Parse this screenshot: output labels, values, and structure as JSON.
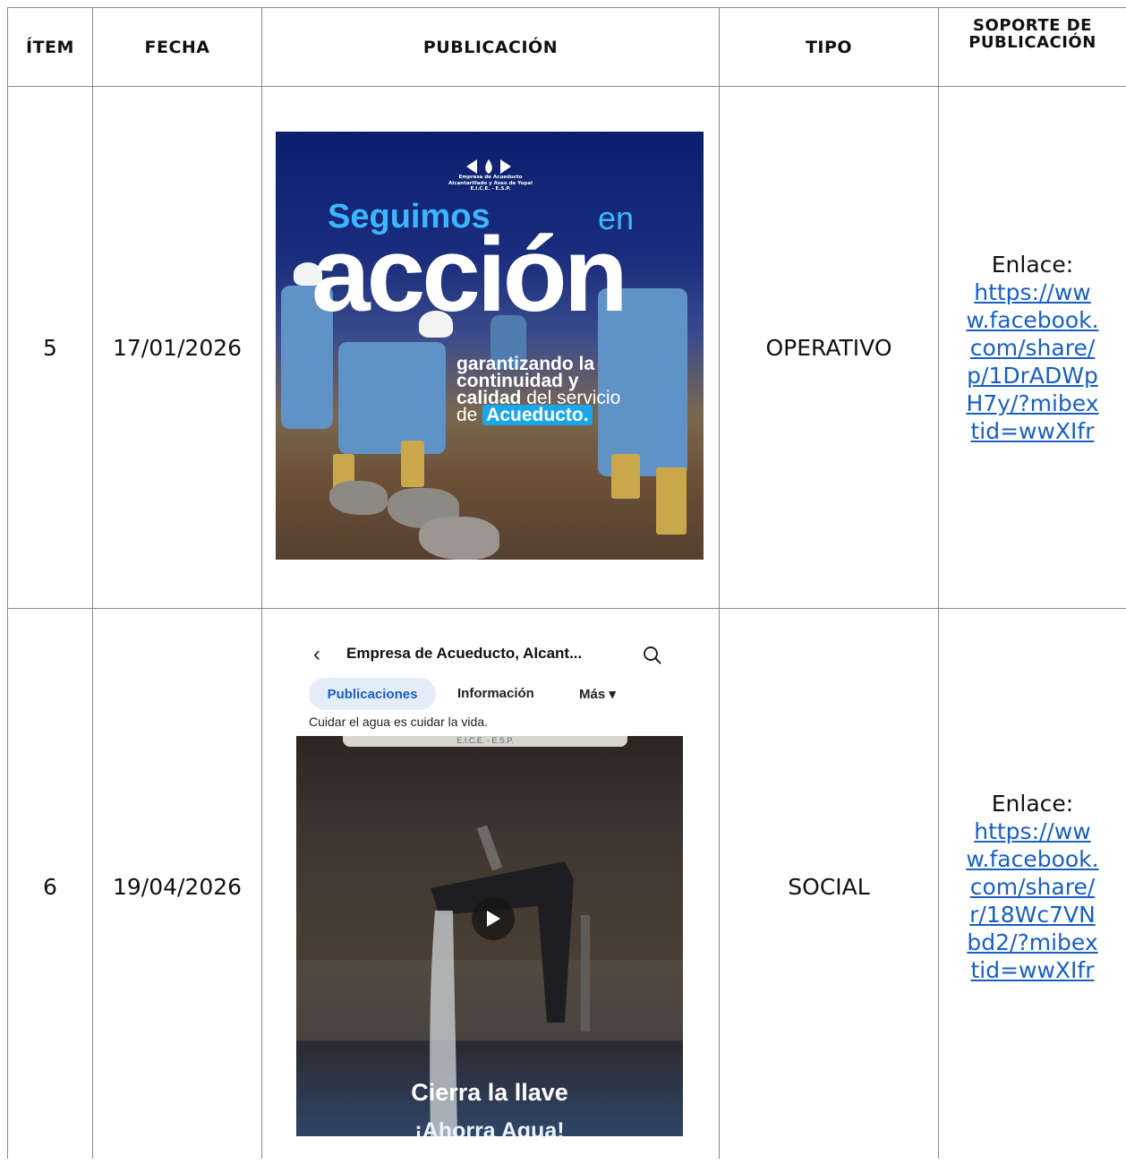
{
  "headers": {
    "item": "ÍTEM",
    "fecha": "FECHA",
    "publicacion": "PUBLICACIÓN",
    "tipo": "TIPO",
    "soporte_line1": "SOPORTE DE",
    "soporte_line2": "PUBLICACIÓN"
  },
  "rows": [
    {
      "item": "5",
      "fecha": "17/01/2026",
      "tipo": "OPERATIVO",
      "enlace_label": "Enlace:",
      "enlace_url": "https://www.facebook.com/share/p/1DrADWpH7y/?mibextid=wwXIfr",
      "post": {
        "logo_text_1": "Empresa de Acueducto",
        "logo_text_2": "Alcantarillado y Aseo de Yopal",
        "logo_text_3": "E.I.C.E. - E.S.P.",
        "headline_1": "Seguimos",
        "headline_2": "en",
        "headline_3": "acción",
        "sub_1": "garantizando la",
        "sub_2": "continuidad y",
        "sub_3a": "calidad",
        "sub_3b": "del servicio",
        "sub_4a": "de",
        "sub_4b": "Acueducto."
      }
    },
    {
      "item": "6",
      "fecha": "19/04/2026",
      "tipo": "SOCIAL",
      "enlace_label": "Enlace:",
      "enlace_url": "https://www.facebook.com/share/r/18Wc7VNbd2/?mibextid=wwXIfr",
      "post": {
        "page_title": "Empresa de Acueducto, Alcant...",
        "tab_active": "Publicaciones",
        "tab_info": "Información",
        "tab_more": "Más ▾",
        "caption": "Cuidar el agua es cuidar la vida.",
        "banner": "E.I.C.E. - E.S.P.",
        "video_text_1": "Cierra la llave",
        "video_text_2": "¡Ahorra Agua!"
      }
    }
  ],
  "colors": {
    "link": "#1a5fc0",
    "grid": "#8a8a8a",
    "brand_blue": "#3cb7ff"
  }
}
